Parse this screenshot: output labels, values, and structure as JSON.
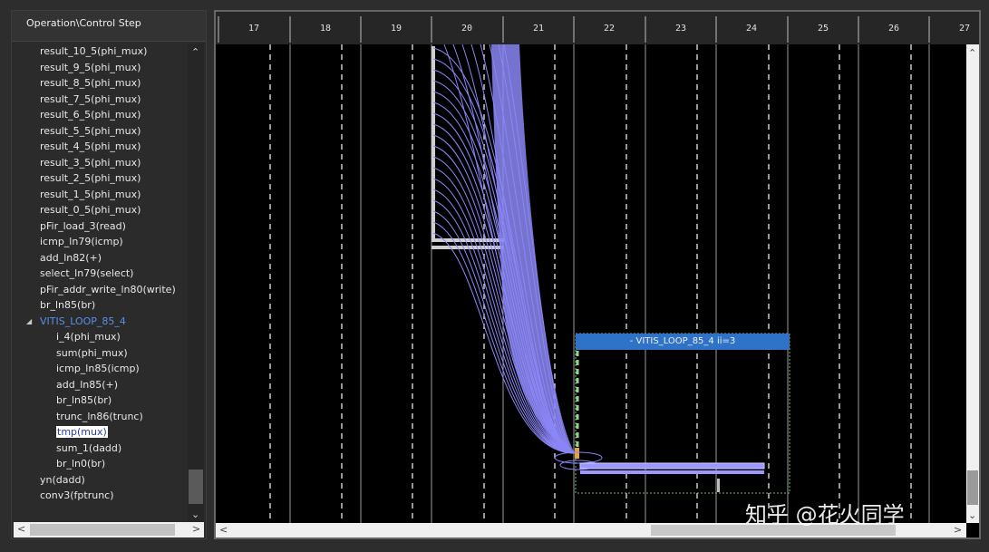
{
  "tree": {
    "header": "Operation\\Control Step",
    "items": [
      "result_10_5(phi_mux)",
      "result_9_5(phi_mux)",
      "result_8_5(phi_mux)",
      "result_7_5(phi_mux)",
      "result_6_5(phi_mux)",
      "result_5_5(phi_mux)",
      "result_4_5(phi_mux)",
      "result_3_5(phi_mux)",
      "result_2_5(phi_mux)",
      "result_1_5(phi_mux)",
      "result_0_5(phi_mux)",
      "pFir_load_3(read)",
      "icmp_ln79(icmp)",
      "add_ln82(+)",
      "select_ln79(select)",
      "pFir_addr_write_ln80(write)",
      "br_ln85(br)",
      "VITIS_LOOP_85_4",
      "i_4(phi_mux)",
      "sum(phi_mux)",
      "icmp_ln85(icmp)",
      "add_ln85(+)",
      "br_ln85(br)",
      "trunc_ln86(trunc)",
      "tmp(mux)",
      "sum_1(dadd)",
      "br_ln0(br)",
      "yn(dadd)",
      "conv3(fptrunc)"
    ]
  },
  "steps": [
    "17",
    "18",
    "19",
    "20",
    "21",
    "22",
    "23",
    "24",
    "25",
    "26",
    "27"
  ],
  "loop_region": {
    "title": "- VITIS_LOOP_85_4   ii=3"
  },
  "colors": {
    "edge": "#8b86f5",
    "loop_header": "#2f73c9",
    "selected_text": "#2b3f9f"
  },
  "watermark": "知乎 @花火同学"
}
